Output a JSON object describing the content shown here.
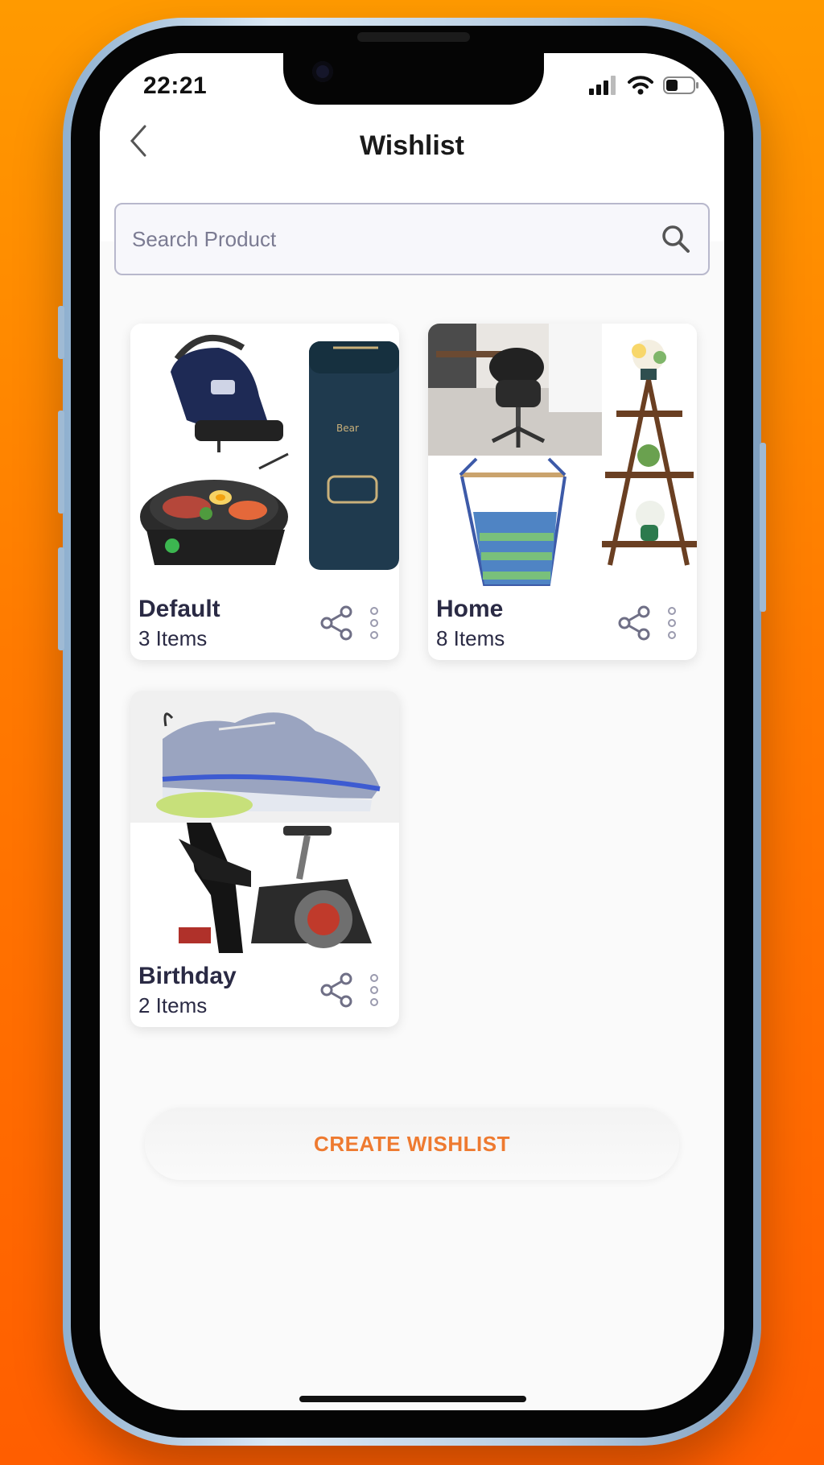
{
  "status_bar": {
    "time": "22:21"
  },
  "header": {
    "title": "Wishlist"
  },
  "search": {
    "placeholder": "Search Product"
  },
  "wishlists": [
    {
      "name": "Default",
      "count": "3 Items"
    },
    {
      "name": "Home",
      "count": "8 Items"
    },
    {
      "name": "Birthday",
      "count": "2 Items"
    }
  ],
  "actions": {
    "create_label": "CREATE WISHLIST"
  },
  "colors": {
    "accent": "#ee7a30",
    "background": "#ff8a00",
    "text": "#2a2a44"
  }
}
